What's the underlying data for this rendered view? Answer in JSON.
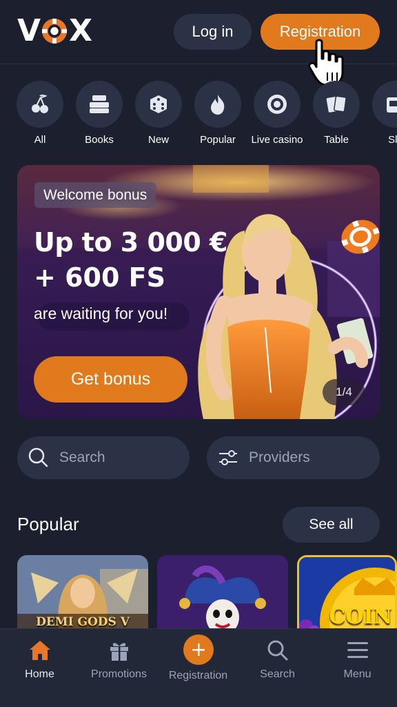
{
  "header": {
    "logo_text_left": "V",
    "logo_text_right": "X",
    "login_label": "Log in",
    "register_label": "Registration"
  },
  "categories": [
    {
      "label": "All",
      "icon": "cherries-icon"
    },
    {
      "label": "Books",
      "icon": "books-icon"
    },
    {
      "label": "New",
      "icon": "dice-icon"
    },
    {
      "label": "Popular",
      "icon": "flame-icon"
    },
    {
      "label": "Live casino",
      "icon": "roulette-icon"
    },
    {
      "label": "Table",
      "icon": "cards-icon"
    },
    {
      "label": "Slo",
      "icon": "slot-machine-icon"
    }
  ],
  "banner": {
    "badge": "Welcome bonus",
    "headline_1": "Up to 3 000 €",
    "headline_2": "+ 600 FS",
    "subline": "are waiting for you!",
    "cta_label": "Get bonus",
    "pager": "1/4"
  },
  "search": {
    "search_label": "Search",
    "providers_label": "Providers"
  },
  "popular": {
    "title": "Popular",
    "see_all_label": "See all",
    "games": [
      {
        "label": "DEMI GODS V"
      },
      {
        "label": ""
      },
      {
        "label": "COIN"
      }
    ]
  },
  "bottom_nav": [
    {
      "label": "Home",
      "icon": "home-icon"
    },
    {
      "label": "Promotions",
      "icon": "gift-icon"
    },
    {
      "label": "Registration",
      "icon": "plus-icon"
    },
    {
      "label": "Search",
      "icon": "search-icon"
    },
    {
      "label": "Menu",
      "icon": "hamburger-menu-icon"
    }
  ],
  "colors": {
    "background": "#1b1f2e",
    "surface": "#2c3246",
    "accent": "#e17a1d",
    "muted_text": "#9aa3b8"
  }
}
